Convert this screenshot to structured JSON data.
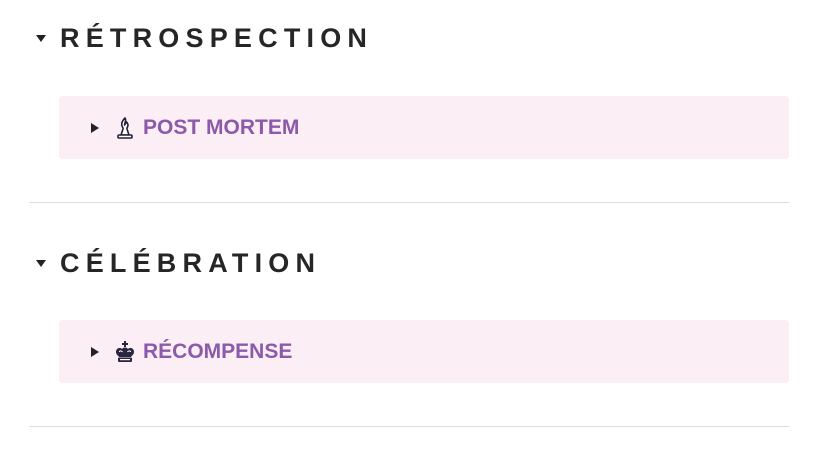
{
  "sections": [
    {
      "heading": "RÉTROSPECTION",
      "callout": {
        "icon": "bishop-chess-icon",
        "label": "POST MORTEM"
      }
    },
    {
      "heading": "CÉLÉBRATION",
      "callout": {
        "icon": "king-chess-icon",
        "label": "RÉCOMPENSE"
      }
    }
  ],
  "colors": {
    "callout_background": "#fbeef4",
    "callout_label": "#8b5aab",
    "heading": "#262626",
    "divider": "#dedede"
  }
}
